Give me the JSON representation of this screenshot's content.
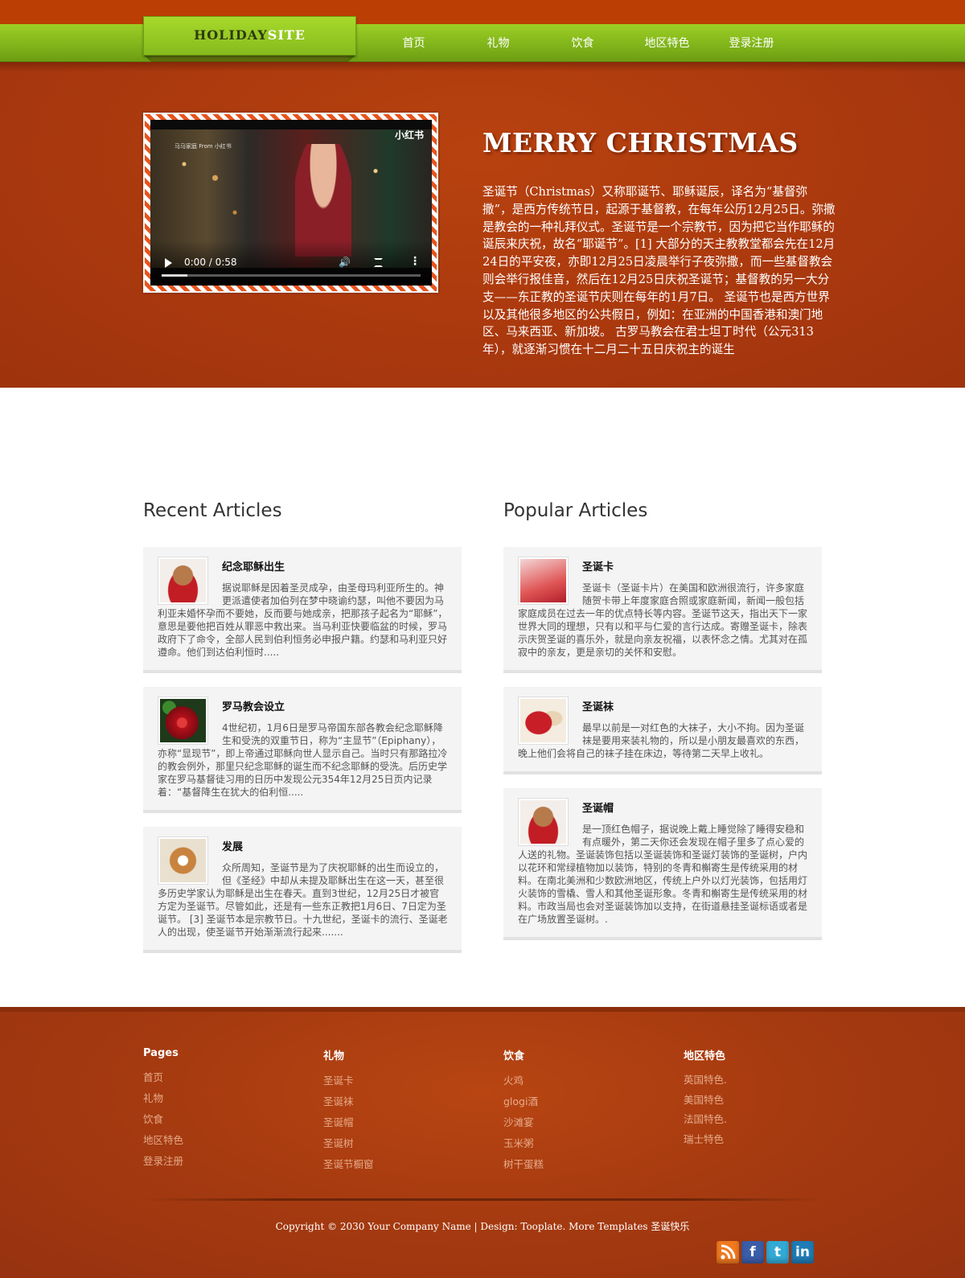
{
  "logo": {
    "part1": "HOLIDAY",
    "part2": "SITE"
  },
  "nav": [
    "首页",
    "礼物",
    "饮食",
    "地区特色",
    "登录注册"
  ],
  "video": {
    "brand": "马马家庭 From 小红书",
    "watermark": "小红书",
    "time": "0:00 / 0:58",
    "progress": 0.1
  },
  "hero": {
    "title": "MERRY CHRISTMAS",
    "text": "圣诞节（Christmas）又称耶诞节、耶稣诞辰，译名为“基督弥撒”，是西方传统节日，起源于基督教，在每年公历12月25日。弥撒是教会的一种礼拜仪式。圣诞节是一个宗教节，因为把它当作耶稣的诞辰来庆祝，故名“耶诞节”。[1] 大部分的天主教教堂都会先在12月24日的平安夜，亦即12月25日凌晨举行子夜弥撒，而一些基督教会则会举行报佳音，然后在12月25日庆祝圣诞节；基督教的另一大分支——东正教的圣诞节庆则在每年的1月7日。 圣诞节也是西方世界以及其他很多地区的公共假日，例如：在亚洲的中国香港和澳门地区、马来西亚、新加坡。 古罗马教会在君士坦丁时代（公元313年），就逐渐习惯在十二月二十五日庆祝主的诞生"
  },
  "recent": {
    "heading": "Recent Articles",
    "articles": [
      {
        "title": "纪念耶稣出生",
        "image": "reindeer-toy",
        "text": "据说耶稣是因着圣灵成孕，由圣母玛利亚所生的。神更派遣使者加伯列在梦中晓谕约瑟，叫他不要因为马利亚未婚怀孕而不要她，反而要与她成亲，把那孩子起名为“耶稣”，意思是要他把百姓从罪恶中救出来。当马利亚快要临盆的时候，罗马政府下了命令，全部人民到伯利恒务必申报户籍。约瑟和马利亚只好遵命。他们到达伯利恒时....."
      },
      {
        "title": "罗马教会设立",
        "image": "red-ornament",
        "text": "4世纪初，1月6日是罗马帝国东部各教会纪念耶稣降生和受洗的双重节日，称为“主显节”（Epiphany），亦称“显现节”，即上帝通过耶稣向世人显示自己。当时只有那路拉冷的教会例外，那里只纪念耶稣的诞生而不纪念耶稣的受洗。后历史学家在罗马基督徒习用的日历中发现公元354年12月25日页内记录着：“基督降生在犹大的伯利恒....."
      },
      {
        "title": "发展",
        "image": "snowflake-cookie",
        "text": "众所周知，圣诞节是为了庆祝耶稣的出生而设立的，但《圣经》中却从未提及耶稣出生在这一天，甚至很多历史学家认为耶稣是出生在春天。直到3世纪，12月25日才被官方定为圣诞节。尽管如此，还是有一些东正教把1月6日、7日定为圣诞节。 [3] 圣诞节本是宗教节日。十九世纪，圣诞卡的流行、圣诞老人的出现，使圣诞节开始渐渐流行起来......."
      }
    ]
  },
  "popular": {
    "heading": "Popular Articles",
    "articles": [
      {
        "title": "圣诞卡",
        "image": "christmas-card",
        "text": "圣诞卡（圣诞卡片）在美国和欧洲很流行，许多家庭随贺卡带上年度家庭合照或家庭新闻，新闻一般包括家庭成员在过去一年的优点特长等内容。圣诞节这天，指出天下一家世界大同的理想，只有以和平与仁爱的言行达成。寄赠圣诞卡，除表示庆贺圣诞的喜乐外，就是向亲友祝福，以表怀念之情。尤其对在孤寂中的亲友，更是亲切的关怀和安慰。"
      },
      {
        "title": "圣诞袜",
        "image": "christmas-sock",
        "text": "最早以前是一对红色的大袜子，大小不拘。因为圣诞袜是要用来装礼物的，所以是小朋友最喜欢的东西，晚上他们会将自己的袜子挂在床边，等待第二天早上收礼。"
      },
      {
        "title": "圣诞帽",
        "image": "reindeer-toy",
        "text": "是一顶红色帽子，据说晚上戴上睡觉除了睡得安稳和有点暖外，第二天你还会发现在帽子里多了点心爱的人送的礼物。圣诞装饰包括以圣诞装饰和圣诞灯装饰的圣诞树，户内以花环和常绿植物加以装饰，特别的冬青和槲寄生是传统采用的材料。在南北美洲和少数欧洲地区，传统上户外以灯光装饰，包括用灯火装饰的雪橇、雪人和其他圣诞形象。冬青和槲寄生是传统采用的材料。市政当局也会对圣诞装饰加以支持，在街道悬挂圣诞标语或者是在广场放置圣诞树。."
      }
    ]
  },
  "footer": {
    "columns": [
      {
        "heading": "Pages",
        "links": [
          "首页",
          "礼物",
          "饮食",
          "地区特色",
          "登录注册"
        ]
      },
      {
        "heading": "礼物",
        "links": [
          "圣诞卡",
          "圣诞袜",
          "圣诞帽",
          "圣诞树",
          "圣诞节橱窗"
        ]
      },
      {
        "heading": "饮食",
        "links": [
          "火鸡",
          "glogi酒",
          "沙滩宴",
          "玉米粥",
          "树干蛋糕"
        ]
      },
      {
        "heading": "地区特色",
        "links": [
          "英国特色.",
          "美国特色",
          "法国特色.",
          "瑞士特色"
        ]
      }
    ],
    "copyright": "Copyright © 2030 Your Company Name | Design: Tooplate. More Templates 圣诞快乐",
    "social": [
      {
        "name": "rss-icon",
        "glyph": "",
        "color": "#f07a1f"
      },
      {
        "name": "facebook-icon",
        "glyph": "f",
        "color": "#3b5ea8"
      },
      {
        "name": "twitter-icon",
        "glyph": "t",
        "color": "#33a9d6"
      },
      {
        "name": "linkedin-icon",
        "glyph": "in",
        "color": "#1f7cb6"
      }
    ]
  },
  "colors": {
    "accent": "#ad3b0f",
    "nav_green": "#86bb1d",
    "link": "#e6ab8a"
  }
}
